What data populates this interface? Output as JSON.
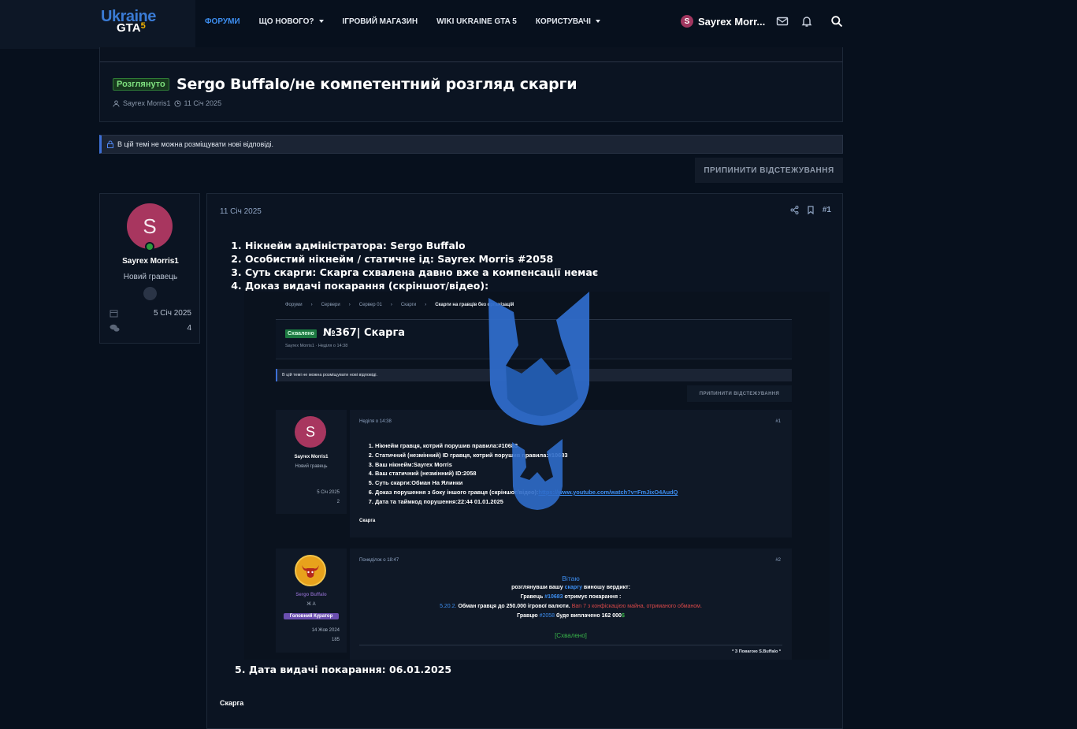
{
  "brand": {
    "logo_top": "Ukraine",
    "logo_bottom": "GTA",
    "logo_five": "5"
  },
  "nav": {
    "items": [
      {
        "label": "ФОРУМИ",
        "active": true,
        "dropdown": false
      },
      {
        "label": "ЩО НОВОГО?",
        "active": false,
        "dropdown": true
      },
      {
        "label": "ІГРОВИЙ МАГАЗИН",
        "active": false,
        "dropdown": false
      },
      {
        "label": "WIKI UKRAINE GTA 5",
        "active": false,
        "dropdown": false
      },
      {
        "label": "КОРИСТУВАЧІ",
        "active": false,
        "dropdown": true
      }
    ],
    "user_initial": "S",
    "user_name": "Sayrex Morr...",
    "icons": [
      "envelope-icon",
      "bell-icon",
      "search-icon"
    ]
  },
  "thread": {
    "prefix": "Розглянуто",
    "title": "Sergo Buffalo/не компетентний розгляд скарги",
    "author": "Sayrex Morris1",
    "date": "11 Січ 2025",
    "locked_notice": "В цій темі не можна розміщувати нові відповіді.",
    "unwatch_label": "ПРИПИНИТИ ВІДСТЕЖУВАННЯ"
  },
  "user_card": {
    "initial": "S",
    "name": "Sayrex Morris1",
    "rank": "Новий гравець",
    "joined": "5 Січ 2025",
    "messages": "4"
  },
  "post": {
    "date": "11 Січ 2025",
    "number": "#1",
    "items": [
      "Нікнейм адміністратора: Sergo Buffalo",
      "Особистий нікнейм / статичне ід: Sayrex Morris #2058",
      "Суть скарги: Скарга схвалена давно вже а компенсації немає",
      "Доказ видачі покарання (скріншот/відео):"
    ],
    "item5": "Дата видачі покарання: 06.01.2025",
    "item5_number": "5.",
    "footer": "Скарга"
  },
  "screenshot": {
    "breadcrumbs": [
      "Форуми",
      "Сервери",
      "Сервер 01",
      "Скарги",
      "Скарги на гравців без організацій"
    ],
    "prefix": "Схвалено",
    "title": "№367| Скарга",
    "meta_author": "Sayrex Morris1",
    "meta_date": "Неділя о 14:38",
    "locked_notice": "В цій темі не можна розміщувати нові відповіді.",
    "unwatch_label": "ПРИПИНИТИ ВІДСТЕЖУВАННЯ",
    "post1": {
      "user_initial": "S",
      "user_name": "Sayrex Morris1",
      "user_rank": "Новий гравець",
      "joined": "5 Січ 2025",
      "messages": "2",
      "date": "Неділя о 14:38",
      "number": "#1",
      "items": [
        "Нікнейм гравця, котрий порушив правила:#10683",
        "Статичний (незмінний) ID гравця, котрий порушив правила:#10683",
        "Ваш нікнейм:Sayrex Morris",
        "Ваш статичний (незмінний) ID:2058",
        "Суть скарги:Обман На Ялинки",
        "Доказ порушення з боку іншого гравця (скріншот/відео):",
        "Дата та таймкод порушення:22:44 01.01.2025"
      ],
      "link": "https://www.youtube.com/watch?v=FmJixO4AudQ",
      "footer": "Скарга"
    },
    "post2": {
      "user_name": "Sergo Buffalo",
      "user_sub": "Ж А",
      "user_rank": "Головний Куратор",
      "joined": "14 Жов 2024",
      "messages": "185",
      "date": "Понеділок о 18:47",
      "number": "#2",
      "greeting": "Вітаю",
      "verdict_a": "розглянувши вашу",
      "verdict_link": "скаргу",
      "verdict_b": "виношу вердикт:",
      "line3_a": "Гравець",
      "line3_id": "#10683",
      "line3_b": "отримує покарання :",
      "rule_num": "5.20.2.",
      "rule_text": "Обман гравця до 250.000 ігрової валюти.",
      "rule_penalty": "Ban 7 з конфіскацією майна, отриманого обманом.",
      "line5_a": "Гравцю",
      "line5_id": "#2058",
      "line5_b": "буде виплачено 162 000",
      "line5_cur": "$",
      "status": "[Схвалено]",
      "signature": "* З Повагою S.Buffalo *"
    }
  },
  "colors": {
    "accent": "#3d8ef0",
    "approved_green": "#2f7a36",
    "avatar": "#a8365f",
    "bg": "#07101d",
    "panel": "#0b1422"
  }
}
